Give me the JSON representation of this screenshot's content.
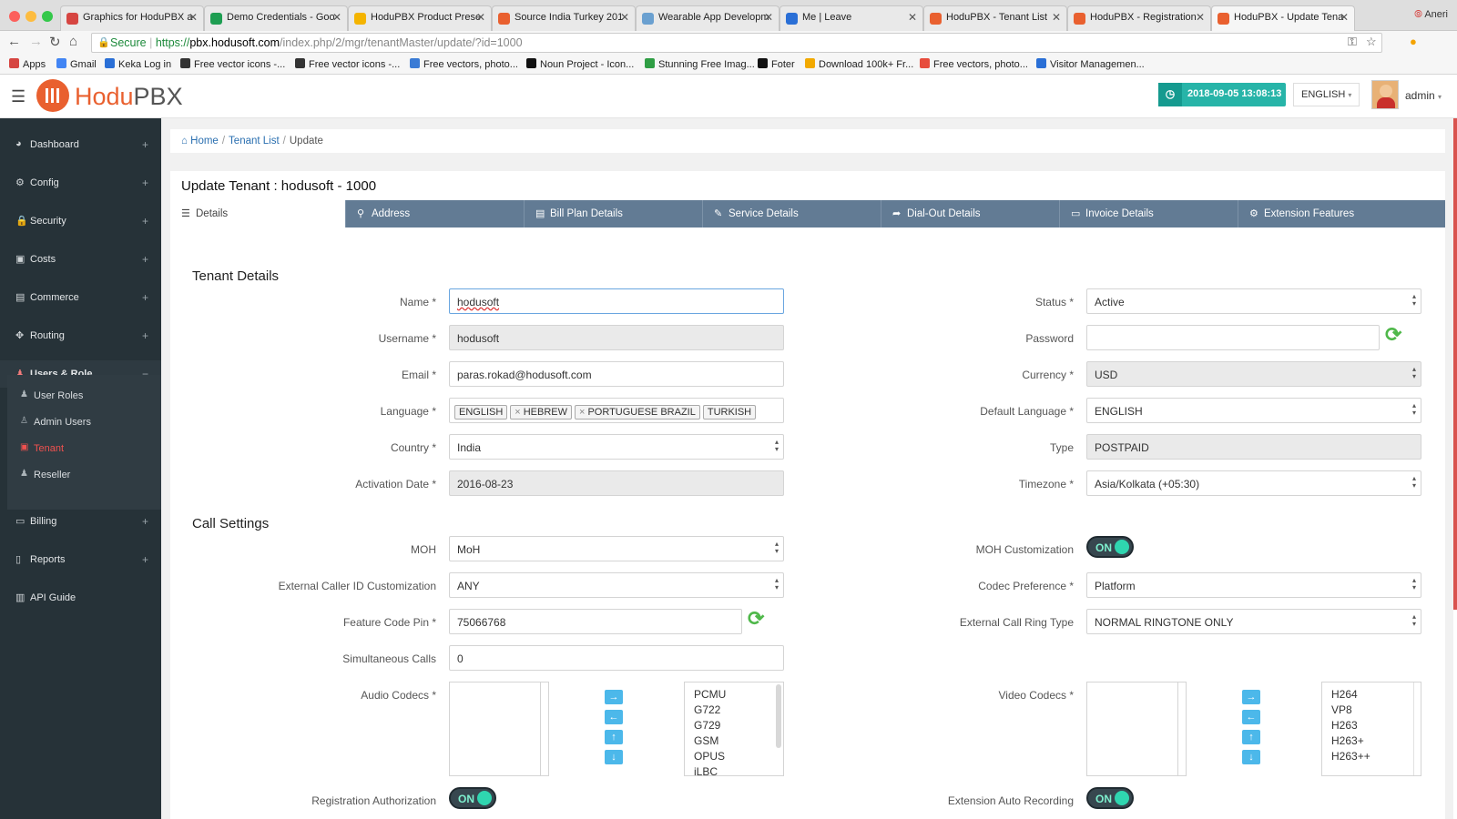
{
  "browser": {
    "tabs": [
      {
        "title": "Graphics for HoduPBX a",
        "color": "#d64541"
      },
      {
        "title": "Demo Credentials - Goo",
        "color": "#1e9e52"
      },
      {
        "title": "HoduPBX Product Prese",
        "color": "#f4b400"
      },
      {
        "title": "Source India Turkey 201",
        "color": "#e9602f"
      },
      {
        "title": "Wearable App Developm",
        "color": "#6aa0d0"
      },
      {
        "title": "Me | Leave",
        "color": "#2a6fd6"
      },
      {
        "title": "HoduPBX - Tenant List",
        "color": "#e9602f"
      },
      {
        "title": "HoduPBX - Registration",
        "color": "#e9602f"
      },
      {
        "title": "HoduPBX - Update Tena",
        "color": "#e9602f"
      }
    ],
    "user": "Aneri",
    "secure_label": "Secure",
    "url_scheme": "https://",
    "url_host": "pbx.hodusoft.com",
    "url_path": "/index.php/2/mgr/tenantMaster/update/?id=1000",
    "bookmarks": [
      {
        "label": "Apps",
        "color": "#d64541"
      },
      {
        "label": "Gmail",
        "color": "#4285f4"
      },
      {
        "label": "Keka Log in",
        "color": "#2a6fd6"
      },
      {
        "label": "Free vector icons -...",
        "color": "#333333"
      },
      {
        "label": "Free vector icons -...",
        "color": "#333333"
      },
      {
        "label": "Free vectors, photo...",
        "color": "#3a7bd5"
      },
      {
        "label": "Noun Project - Icon...",
        "color": "#111111"
      },
      {
        "label": "Stunning Free Imag...",
        "color": "#2f9e44"
      },
      {
        "label": "Foter",
        "color": "#111111"
      },
      {
        "label": "Download 100k+ Fr...",
        "color": "#f2a900"
      },
      {
        "label": "Free vectors, photo...",
        "color": "#e74c3c"
      },
      {
        "label": "Visitor Managemen...",
        "color": "#2a6fd6"
      }
    ]
  },
  "header": {
    "logo_hodu": "Hodu",
    "logo_pbx": "PBX",
    "datetime": "2018-09-05 13:08:13",
    "language": "ENGLISH",
    "user": "admin"
  },
  "sidebar": {
    "items": [
      {
        "label": "Dashboard",
        "icon": "dashboard-icon",
        "glyph": "◕",
        "toggle": "+"
      },
      {
        "label": "Config",
        "icon": "cogs-icon",
        "glyph": "⚙",
        "toggle": "+"
      },
      {
        "label": "Security",
        "icon": "lock-icon",
        "glyph": "🔒",
        "toggle": "+"
      },
      {
        "label": "Costs",
        "icon": "money-icon",
        "glyph": "▣",
        "toggle": "+"
      },
      {
        "label": "Commerce",
        "icon": "briefcase-icon",
        "glyph": "▤",
        "toggle": "+"
      },
      {
        "label": "Routing",
        "icon": "arrows-icon",
        "glyph": "✥",
        "toggle": "+"
      },
      {
        "label": "Users & Role",
        "icon": "user-icon",
        "glyph": "♟",
        "toggle": "−"
      },
      {
        "label": "Billing",
        "icon": "credit-card-icon",
        "glyph": "▭",
        "toggle": "+"
      },
      {
        "label": "Reports",
        "icon": "file-icon",
        "glyph": "▯",
        "toggle": "+"
      },
      {
        "label": "API Guide",
        "icon": "book-icon",
        "glyph": "▥",
        "toggle": ""
      }
    ],
    "subitems": [
      {
        "label": "User Roles",
        "icon": "users-icon",
        "glyph": "♟"
      },
      {
        "label": "Admin Users",
        "icon": "user-tie-icon",
        "glyph": "♙"
      },
      {
        "label": "Tenant",
        "icon": "briefcase-icon",
        "glyph": "▣"
      },
      {
        "label": "Reseller",
        "icon": "user-icon",
        "glyph": "♟"
      }
    ]
  },
  "breadcrumb": {
    "home": "Home",
    "list": "Tenant List",
    "current": "Update"
  },
  "page": {
    "title": "Update Tenant : hodusoft - 1000"
  },
  "tabs": [
    {
      "label": "Details",
      "glyph": "☰"
    },
    {
      "label": "Address",
      "glyph": "⚲"
    },
    {
      "label": "Bill Plan Details",
      "glyph": "▤"
    },
    {
      "label": "Service Details",
      "glyph": "✎"
    },
    {
      "label": "Dial-Out Details",
      "glyph": "➦"
    },
    {
      "label": "Invoice Details",
      "glyph": "▭"
    },
    {
      "label": "Extension Features",
      "glyph": "⚙"
    }
  ],
  "tenant": {
    "section": "Tenant Details",
    "name_label": "Name *",
    "name": "hodusoft",
    "username_label": "Username *",
    "username": "hodusoft",
    "email_label": "Email *",
    "email": "paras.rokad@hodusoft.com",
    "language_label": "Language *",
    "languages": [
      "ENGLISH",
      "HEBREW",
      "PORTUGUESE BRAZIL",
      "TURKISH"
    ],
    "country_label": "Country *",
    "country": "India",
    "activation_label": "Activation Date *",
    "activation": "2016-08-23",
    "status_label": "Status *",
    "status": "Active",
    "password_label": "Password",
    "password": "",
    "currency_label": "Currency *",
    "currency": "USD",
    "default_language_label": "Default Language *",
    "default_language": "ENGLISH",
    "type_label": "Type",
    "type": "POSTPAID",
    "timezone_label": "Timezone *",
    "timezone": "Asia/Kolkata (+05:30)"
  },
  "call": {
    "section": "Call Settings",
    "moh_label": "MOH",
    "moh": "MoH",
    "ext_caller_label": "External Caller ID Customization",
    "ext_caller": "ANY",
    "feature_pin_label": "Feature Code Pin *",
    "feature_pin": "75066768",
    "simultaneous_label": "Simultaneous Calls",
    "simultaneous": "0",
    "audio_label": "Audio Codecs *",
    "audio_codecs": [
      "PCMU",
      "G722",
      "G729",
      "GSM",
      "OPUS",
      "iLBC"
    ],
    "reg_auth_label": "Registration Authorization",
    "reg_auth": "ON",
    "moh_custom_label": "MOH Customization",
    "moh_custom": "ON",
    "codec_pref_label": "Codec Preference *",
    "codec_pref": "Platform",
    "ring_type_label": "External Call Ring Type",
    "ring_type": "NORMAL RINGTONE ONLY",
    "video_label": "Video Codecs *",
    "video_codecs": [
      "H264",
      "VP8",
      "H263",
      "H263+",
      "H263++"
    ],
    "ext_rec_label": "Extension Auto Recording",
    "ext_rec": "ON"
  },
  "arrows": [
    "→",
    "←",
    "↑",
    "↓"
  ]
}
